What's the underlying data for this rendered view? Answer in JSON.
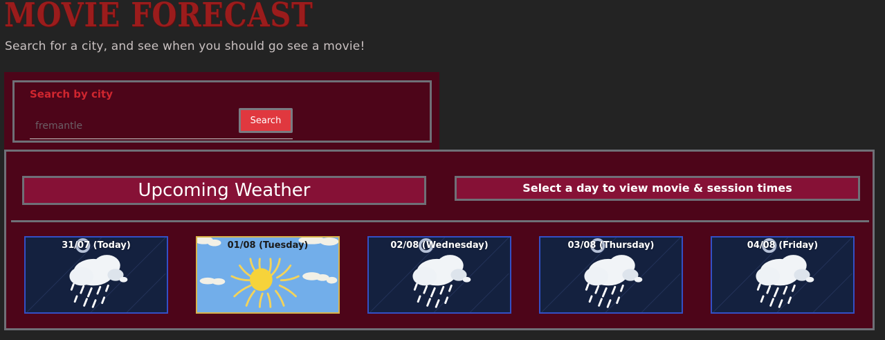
{
  "header": {
    "title": "Movie Forecast",
    "subtitle": "Search for a city, and see when you should go see a movie!"
  },
  "search": {
    "label": "Search by city",
    "placeholder": "fremantle",
    "button_label": "Search"
  },
  "weather": {
    "heading": "Upcoming Weather",
    "session_hint": "Select a day to view movie & session times",
    "days": [
      {
        "label": "31/07 (Today)",
        "icon": "rain-cloud-icon"
      },
      {
        "label": "01/08 (Tuesday)",
        "icon": "sun-icon"
      },
      {
        "label": "02/08 (Wednesday)",
        "icon": "rain-cloud-icon"
      },
      {
        "label": "03/08 (Thursday)",
        "icon": "rain-cloud-icon"
      },
      {
        "label": "04/08 (Friday)",
        "icon": "rain-cloud-icon"
      }
    ]
  },
  "colors": {
    "background": "#232323",
    "title": "#9b1c1c",
    "panel": "#4d0519",
    "heading_box": "#861136",
    "search_label": "#d0262f",
    "search_button": "#e0383f",
    "rain_card": "#14213f",
    "rain_border": "#3350c6",
    "sun_card": "#72aeea",
    "sun_border": "#d9b44a"
  }
}
